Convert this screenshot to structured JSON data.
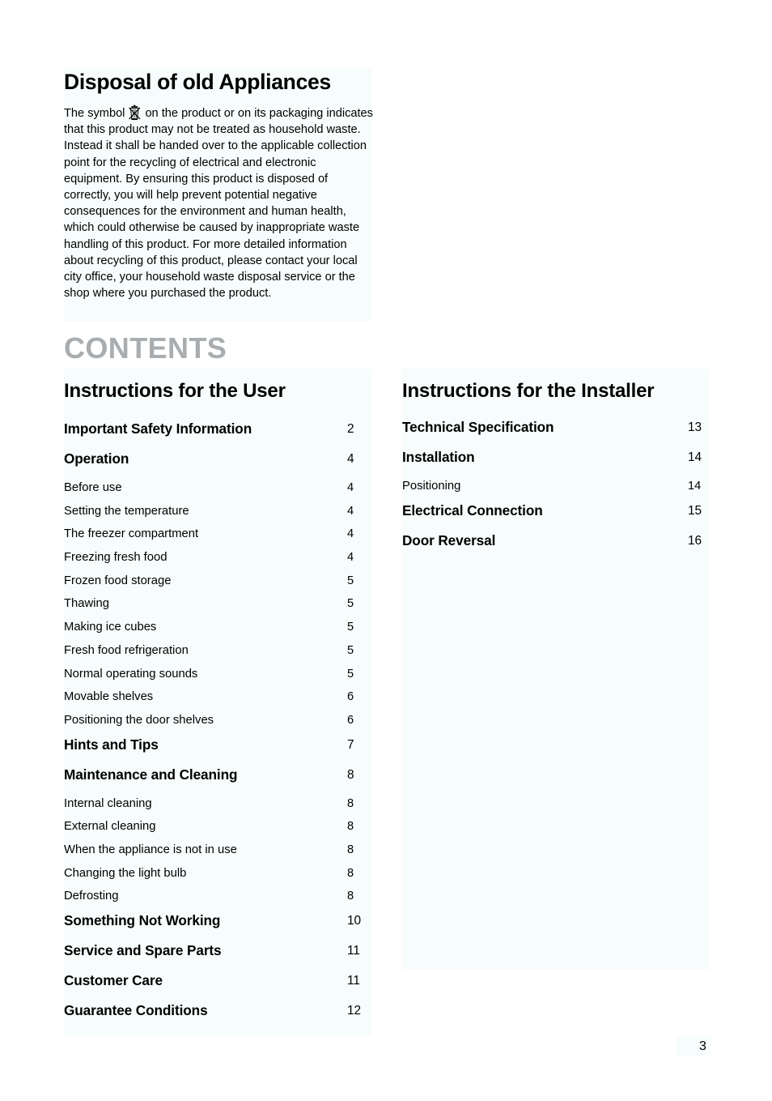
{
  "disposal": {
    "title": "Disposal of old Appliances",
    "icon_name": "crossed-out-wheelie-bin-icon",
    "body_before_icon": "The symbol",
    "body_after_icon": "on the product or on its packaging indicates that this product may not be treated as household waste. Instead it shall be handed over to the applicable collection point for the recycling of electrical and electronic equipment. By ensuring this product is disposed of correctly, you will help prevent potential negative consequences for the environment and human health, which could otherwise be caused by inappropriate waste handling of this product. For more detailed information about recycling of this product, please contact your local city office, your household waste disposal service or the shop where you purchased the product."
  },
  "contents_heading": "CONTENTS",
  "colors": {
    "contents_heading": "#a9adaf",
    "panel_tint": "#f7fcfd",
    "text": "#000000"
  },
  "columns": {
    "left": {
      "heading": "Instructions for the User",
      "entries": [
        {
          "label": "Important Safety Information",
          "page": "2",
          "level": "major"
        },
        {
          "label": "Operation",
          "page": "4",
          "level": "major"
        },
        {
          "label": "Before use",
          "page": "4",
          "level": "minor"
        },
        {
          "label": "Setting the temperature",
          "page": "4",
          "level": "minor"
        },
        {
          "label": "The freezer compartment",
          "page": "4",
          "level": "minor"
        },
        {
          "label": "Freezing fresh food",
          "page": "4",
          "level": "minor"
        },
        {
          "label": "Frozen food storage",
          "page": "5",
          "level": "minor"
        },
        {
          "label": "Thawing",
          "page": "5",
          "level": "minor"
        },
        {
          "label": "Making ice cubes",
          "page": "5",
          "level": "minor"
        },
        {
          "label": "Fresh food refrigeration",
          "page": "5",
          "level": "minor"
        },
        {
          "label": "Normal operating sounds",
          "page": "5",
          "level": "minor"
        },
        {
          "label": "Movable shelves",
          "page": "6",
          "level": "minor"
        },
        {
          "label": "Positioning the door shelves",
          "page": "6",
          "level": "minor"
        },
        {
          "label": "Hints and Tips",
          "page": "7",
          "level": "major"
        },
        {
          "label": "Maintenance and Cleaning",
          "page": "8",
          "level": "major"
        },
        {
          "label": "Internal cleaning",
          "page": "8",
          "level": "minor"
        },
        {
          "label": "External cleaning",
          "page": "8",
          "level": "minor"
        },
        {
          "label": "When the appliance is not in use",
          "page": "8",
          "level": "minor"
        },
        {
          "label": "Changing the light bulb",
          "page": "8",
          "level": "minor"
        },
        {
          "label": "Defrosting",
          "page": "8",
          "level": "minor"
        },
        {
          "label": "Something Not Working",
          "page": "10",
          "level": "major"
        },
        {
          "label": "Service and Spare Parts",
          "page": "11",
          "level": "major"
        },
        {
          "label": "Customer Care",
          "page": "11",
          "level": "major"
        },
        {
          "label": "Guarantee Conditions",
          "page": "12",
          "level": "major"
        }
      ]
    },
    "right": {
      "heading": "Instructions for the Installer",
      "entries": [
        {
          "label": "Technical Specification",
          "page": "13",
          "level": "major"
        },
        {
          "label": "Installation",
          "page": "14",
          "level": "major"
        },
        {
          "label": "Positioning",
          "page": "14",
          "level": "minor"
        },
        {
          "label": "Electrical Connection",
          "page": "15",
          "level": "major"
        },
        {
          "label": "Door Reversal",
          "page": "16",
          "level": "major"
        }
      ]
    }
  },
  "page_number": "3"
}
